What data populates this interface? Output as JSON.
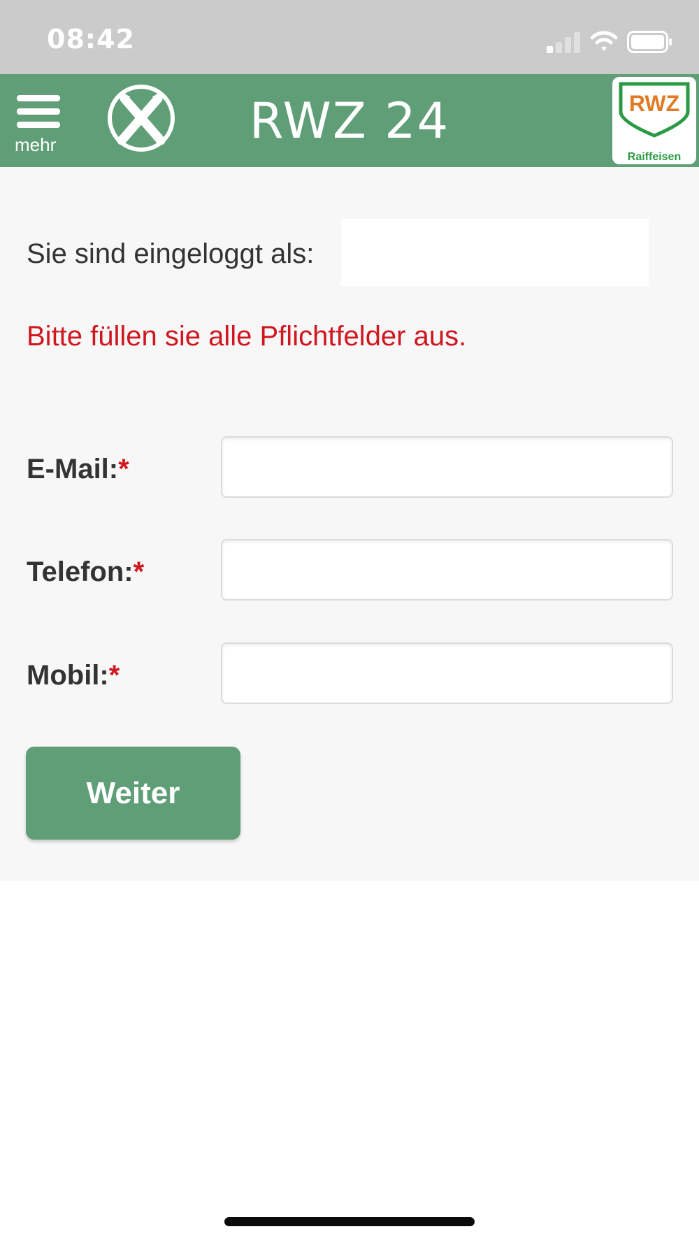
{
  "status_bar": {
    "time": "08:42",
    "signal_icon": "cellular-signal-icon",
    "wifi_icon": "wifi-icon",
    "battery_icon": "battery-icon"
  },
  "header": {
    "menu_label": "mehr",
    "menu_icon": "hamburger-menu-icon",
    "title": "RWZ 24",
    "left_logo": "raiffeisen-crossed-horses-logo",
    "right_logo": {
      "text": "RWZ",
      "subtext": "Raiffeisen"
    },
    "background_color": "#5f9e77"
  },
  "content": {
    "logged_in_label": "Sie sind eingeloggt als:",
    "logged_in_value": "",
    "error_message": "Bitte füllen sie alle Pflichtfelder aus.",
    "error_color": "#d0161e",
    "required_marker": "*",
    "fields": [
      {
        "label": "E-Mail:",
        "value": "",
        "placeholder": ""
      },
      {
        "label": "Telefon:",
        "value": "",
        "placeholder": ""
      },
      {
        "label": "Mobil:",
        "value": "",
        "placeholder": ""
      }
    ],
    "submit_label": "Weiter"
  }
}
